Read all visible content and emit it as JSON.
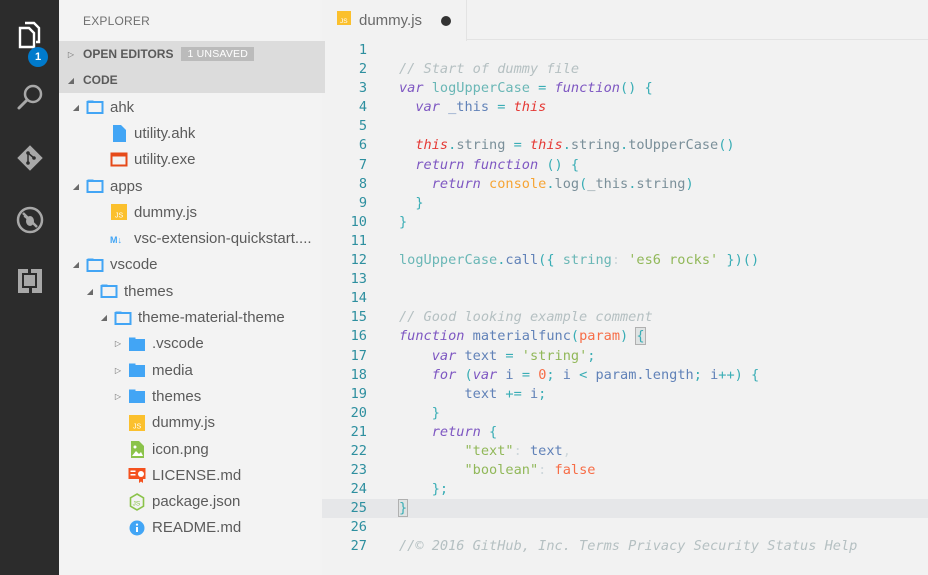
{
  "activity_bar": {
    "items": [
      {
        "name": "explorer",
        "icon": "files-icon",
        "badge": "1"
      },
      {
        "name": "search",
        "icon": "search-icon"
      },
      {
        "name": "git",
        "icon": "git-icon"
      },
      {
        "name": "debug",
        "icon": "debug-icon"
      },
      {
        "name": "extensions",
        "icon": "extensions-icon"
      }
    ]
  },
  "sidebar": {
    "title": "EXPLORER",
    "open_editors": {
      "label": "OPEN EDITORS",
      "badge": "1 UNSAVED"
    },
    "code_section": {
      "label": "CODE"
    },
    "tree": [
      {
        "label": "ahk",
        "type": "folder-open",
        "depth": 1,
        "expanded": true
      },
      {
        "label": "utility.ahk",
        "type": "file-ahk",
        "depth": 2
      },
      {
        "label": "utility.exe",
        "type": "file-exe",
        "depth": 2
      },
      {
        "label": "apps",
        "type": "folder-open",
        "depth": 1,
        "expanded": true
      },
      {
        "label": "dummy.js",
        "type": "file-js",
        "depth": 2
      },
      {
        "label": "vsc-extension-quickstart....",
        "type": "file-md",
        "depth": 2
      },
      {
        "label": "vscode",
        "type": "folder-open",
        "depth": 1,
        "expanded": true
      },
      {
        "label": "themes",
        "type": "folder-open",
        "depth": 2,
        "expanded": true
      },
      {
        "label": "theme-material-theme",
        "type": "folder-open",
        "depth": 3,
        "expanded": true
      },
      {
        "label": ".vscode",
        "type": "folder-closed",
        "depth": 4,
        "expanded": false
      },
      {
        "label": "media",
        "type": "folder-closed",
        "depth": 4,
        "expanded": false
      },
      {
        "label": "themes",
        "type": "folder-closed",
        "depth": 4,
        "expanded": false
      },
      {
        "label": "dummy.js",
        "type": "file-js",
        "depth": 4
      },
      {
        "label": "icon.png",
        "type": "file-image",
        "depth": 4
      },
      {
        "label": "LICENSE.md",
        "type": "file-license",
        "depth": 4
      },
      {
        "label": "package.json",
        "type": "file-node",
        "depth": 4
      },
      {
        "label": "README.md",
        "type": "file-info",
        "depth": 4
      }
    ]
  },
  "editor": {
    "tab": {
      "label": "dummy.js",
      "dirty": true
    },
    "current_line": 25,
    "lines": [
      {
        "n": "1",
        "tokens": []
      },
      {
        "n": "2",
        "tokens": [
          [
            "c-comment",
            "// Start of dummy file"
          ]
        ]
      },
      {
        "n": "3",
        "tokens": [
          [
            "c-kw",
            "var"
          ],
          [
            "c-ident",
            " logUpperCase "
          ],
          [
            "c-op",
            "="
          ],
          [
            "c-ident",
            " "
          ],
          [
            "c-kw",
            "function"
          ],
          [
            "c-punc",
            "() {"
          ]
        ]
      },
      {
        "n": "4",
        "tokens": [
          [
            "c-ident",
            "  "
          ],
          [
            "c-kw",
            "var"
          ],
          [
            "c-plain",
            " _this "
          ],
          [
            "c-op",
            "="
          ],
          [
            "c-plain",
            " "
          ],
          [
            "c-this",
            "this"
          ]
        ]
      },
      {
        "n": "5",
        "tokens": []
      },
      {
        "n": "6",
        "tokens": [
          [
            "c-plain",
            "  "
          ],
          [
            "c-this",
            "this"
          ],
          [
            "c-punc",
            "."
          ],
          [
            "c-prop",
            "string "
          ],
          [
            "c-op",
            "="
          ],
          [
            "c-prop",
            " "
          ],
          [
            "c-this",
            "this"
          ],
          [
            "c-punc",
            "."
          ],
          [
            "c-prop",
            "string"
          ],
          [
            "c-punc",
            "."
          ],
          [
            "c-prop",
            "toUpperCase"
          ],
          [
            "c-punc",
            "()"
          ]
        ]
      },
      {
        "n": "7",
        "tokens": [
          [
            "c-plain",
            "  "
          ],
          [
            "c-kw",
            "return"
          ],
          [
            "c-plain",
            " "
          ],
          [
            "c-kw",
            "function"
          ],
          [
            "c-punc",
            " () {"
          ]
        ]
      },
      {
        "n": "8",
        "tokens": [
          [
            "c-plain",
            "    "
          ],
          [
            "c-kw",
            "return"
          ],
          [
            "c-plain",
            " "
          ],
          [
            "c-console",
            "console"
          ],
          [
            "c-punc",
            "."
          ],
          [
            "c-prop",
            "log"
          ],
          [
            "c-punc",
            "("
          ],
          [
            "c-prop",
            "_this"
          ],
          [
            "c-punc",
            "."
          ],
          [
            "c-prop",
            "string"
          ],
          [
            "c-punc",
            ")"
          ]
        ]
      },
      {
        "n": "9",
        "tokens": [
          [
            "c-punc",
            "  }"
          ]
        ]
      },
      {
        "n": "10",
        "tokens": [
          [
            "c-punc",
            "}"
          ]
        ]
      },
      {
        "n": "11",
        "tokens": []
      },
      {
        "n": "12",
        "tokens": [
          [
            "c-ident",
            "logUpperCase"
          ],
          [
            "c-punc",
            "."
          ],
          [
            "c-fn",
            "call"
          ],
          [
            "c-punc",
            "({ "
          ],
          [
            "c-ident",
            "string"
          ],
          [
            "c-faint",
            ": "
          ],
          [
            "c-str",
            "'es6 rocks'"
          ],
          [
            "c-punc",
            " })()"
          ]
        ]
      },
      {
        "n": "13",
        "tokens": []
      },
      {
        "n": "14",
        "tokens": []
      },
      {
        "n": "15",
        "tokens": [
          [
            "c-comment",
            "// Good looking example comment"
          ]
        ]
      },
      {
        "n": "16",
        "tokens": [
          [
            "c-kw",
            "function"
          ],
          [
            "c-plain",
            " materialfunc"
          ],
          [
            "c-punc",
            "("
          ],
          [
            "c-param",
            "param"
          ],
          [
            "c-punc",
            ") "
          ],
          [
            "bracket-match c-punc",
            "{"
          ]
        ]
      },
      {
        "n": "17",
        "tokens": [
          [
            "c-plain",
            "    "
          ],
          [
            "c-kw",
            "var"
          ],
          [
            "c-plain",
            " text "
          ],
          [
            "c-op",
            "="
          ],
          [
            "c-plain",
            " "
          ],
          [
            "c-str",
            "'string'"
          ],
          [
            "c-punc",
            ";"
          ]
        ]
      },
      {
        "n": "18",
        "tokens": [
          [
            "c-plain",
            "    "
          ],
          [
            "c-kw",
            "for"
          ],
          [
            "c-punc",
            " ("
          ],
          [
            "c-kw",
            "var"
          ],
          [
            "c-plain",
            " i "
          ],
          [
            "c-op",
            "="
          ],
          [
            "c-plain",
            " "
          ],
          [
            "c-num",
            "0"
          ],
          [
            "c-punc",
            ";"
          ],
          [
            "c-plain",
            " i "
          ],
          [
            "c-op",
            "<"
          ],
          [
            "c-plain",
            " param.length"
          ],
          [
            "c-punc",
            ";"
          ],
          [
            "c-plain",
            " i"
          ],
          [
            "c-op",
            "++"
          ],
          [
            "c-punc",
            ") {"
          ]
        ]
      },
      {
        "n": "19",
        "tokens": [
          [
            "c-plain",
            "        text "
          ],
          [
            "c-op",
            "+="
          ],
          [
            "c-plain",
            " i"
          ],
          [
            "c-punc",
            ";"
          ]
        ]
      },
      {
        "n": "20",
        "tokens": [
          [
            "c-punc",
            "    }"
          ]
        ]
      },
      {
        "n": "21",
        "tokens": [
          [
            "c-plain",
            "    "
          ],
          [
            "c-kw",
            "return"
          ],
          [
            "c-punc",
            " {"
          ]
        ]
      },
      {
        "n": "22",
        "tokens": [
          [
            "c-plain",
            "        "
          ],
          [
            "c-key",
            "\"text\""
          ],
          [
            "c-faint",
            ": "
          ],
          [
            "c-plain",
            "text"
          ],
          [
            "c-faint",
            ","
          ]
        ]
      },
      {
        "n": "23",
        "tokens": [
          [
            "c-plain",
            "        "
          ],
          [
            "c-key",
            "\"boolean\""
          ],
          [
            "c-faint",
            ": "
          ],
          [
            "c-bool",
            "false"
          ]
        ]
      },
      {
        "n": "24",
        "tokens": [
          [
            "c-punc",
            "    };"
          ]
        ]
      },
      {
        "n": "25",
        "tokens": [
          [
            "bracket-match c-punc",
            "}"
          ]
        ]
      },
      {
        "n": "26",
        "tokens": []
      },
      {
        "n": "27",
        "tokens": [
          [
            "c-comment",
            "//© 2016 GitHub, Inc. Terms Privacy Security Status Help"
          ]
        ]
      }
    ]
  },
  "colors": {
    "activity_bar_bg": "#2c2c2c",
    "badge_blue": "#007acc",
    "sidebar_bg": "#f3f3f3",
    "section_header_bg": "#dcdcdc",
    "editor_bg": "#f2f2f2",
    "line_number": "#2d8f9f",
    "keyword": "#7e57c2",
    "string": "#91b859",
    "this": "#e53935"
  }
}
